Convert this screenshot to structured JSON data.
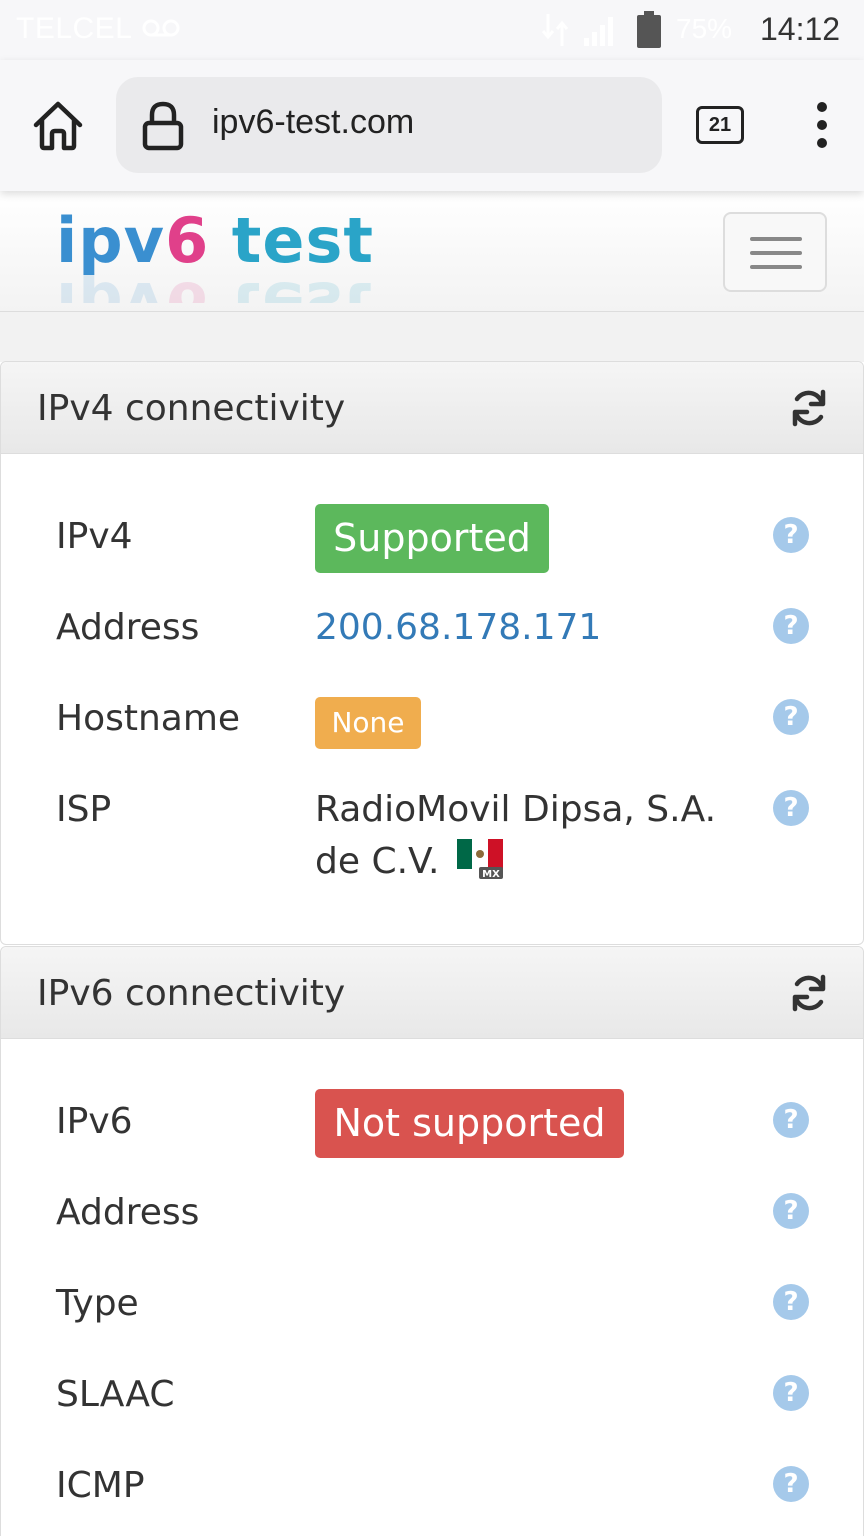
{
  "status_bar": {
    "carrier": "TELCEL",
    "battery": "75%",
    "time": "14:12"
  },
  "browser": {
    "url": "ipv6-test.com",
    "tab_count": "21"
  },
  "site": {
    "logo_part1": "ipv",
    "logo_part2": "6",
    "logo_part3": " test"
  },
  "ipv4": {
    "title": "IPv4 connectivity",
    "rows": [
      {
        "label": "IPv4",
        "value": "Supported"
      },
      {
        "label": "Address",
        "value": "200.68.178.171"
      },
      {
        "label": "Hostname",
        "value": "None"
      },
      {
        "label": "ISP",
        "value": "RadioMovil Dipsa, S.A. de C.V."
      }
    ],
    "country_code": "MX",
    "colors": {
      "supported": "#5cb85c",
      "none": "#f0ad4e",
      "link": "#337ab7"
    }
  },
  "ipv6": {
    "title": "IPv6 connectivity",
    "rows": [
      {
        "label": "IPv6",
        "value": "Not supported"
      },
      {
        "label": "Address",
        "value": ""
      },
      {
        "label": "Type",
        "value": ""
      },
      {
        "label": "SLAAC",
        "value": ""
      },
      {
        "label": "ICMP",
        "value": ""
      }
    ],
    "colors": {
      "not_supported": "#d9534f"
    }
  },
  "help_icon_glyph": "?"
}
